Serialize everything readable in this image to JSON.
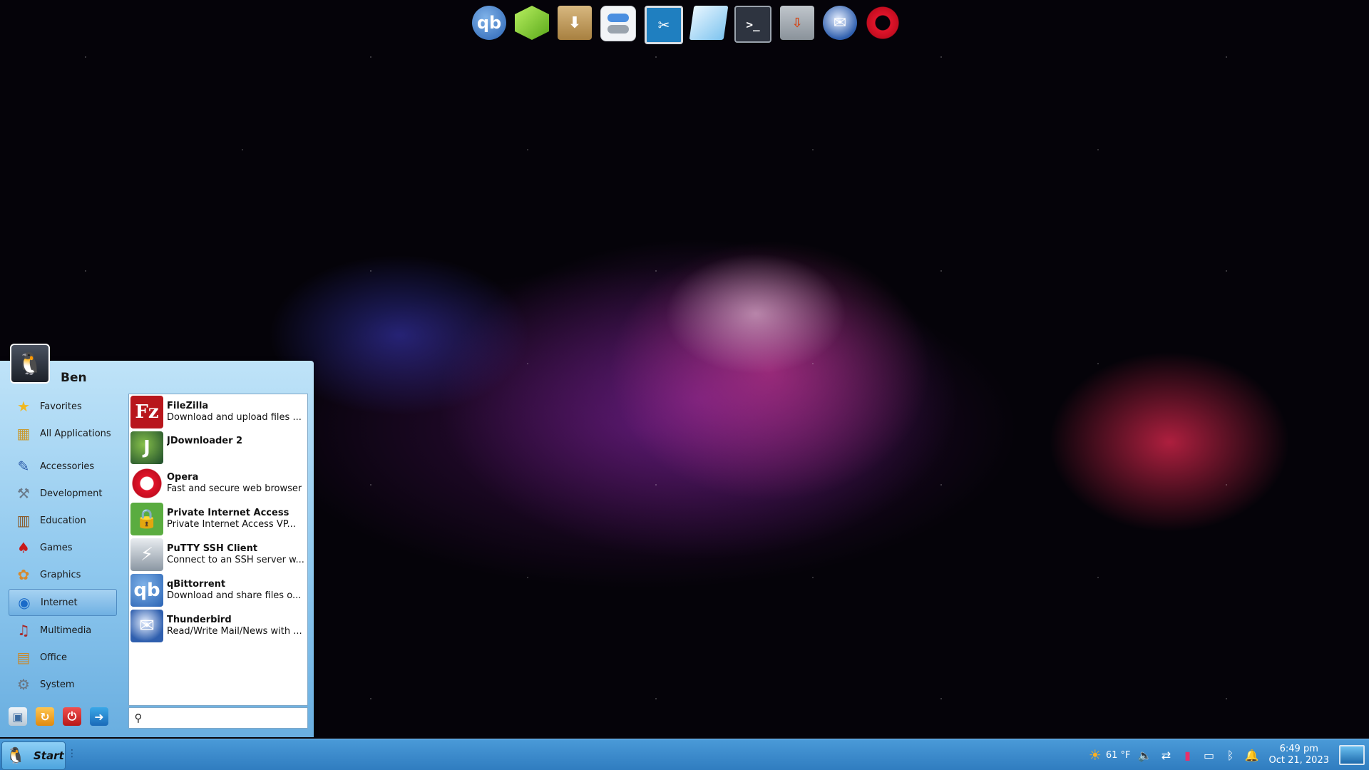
{
  "dock": {
    "icons": [
      {
        "name": "qbittorrent-icon",
        "glyph": "qb"
      },
      {
        "name": "cube-app-icon",
        "glyph": ""
      },
      {
        "name": "archive-manager-icon",
        "glyph": "⬇"
      },
      {
        "name": "settings-toggle-icon",
        "glyph": ""
      },
      {
        "name": "remote-desktop-icon",
        "glyph": "✂"
      },
      {
        "name": "text-editor-icon",
        "glyph": ""
      },
      {
        "name": "terminal-icon",
        "glyph": ">_"
      },
      {
        "name": "network-tool-icon",
        "glyph": "⇩"
      },
      {
        "name": "thunderbird-icon",
        "glyph": "✉"
      },
      {
        "name": "opera-icon",
        "glyph": ""
      }
    ]
  },
  "start_menu": {
    "user_name": "Ben",
    "categories": [
      {
        "label": "Favorites",
        "icon": "★",
        "icon_name": "star-icon"
      },
      {
        "label": "All Applications",
        "icon": "▦",
        "icon_name": "applications-icon"
      },
      {
        "label": "Accessories",
        "icon": "✎",
        "icon_name": "accessories-icon"
      },
      {
        "label": "Development",
        "icon": "⚒",
        "icon_name": "development-icon"
      },
      {
        "label": "Education",
        "icon": "▥",
        "icon_name": "education-icon"
      },
      {
        "label": "Games",
        "icon": "♠",
        "icon_name": "games-icon"
      },
      {
        "label": "Graphics",
        "icon": "✿",
        "icon_name": "graphics-icon"
      },
      {
        "label": "Internet",
        "icon": "◉",
        "icon_name": "globe-icon"
      },
      {
        "label": "Multimedia",
        "icon": "♫",
        "icon_name": "multimedia-icon"
      },
      {
        "label": "Office",
        "icon": "▤",
        "icon_name": "office-icon"
      },
      {
        "label": "System",
        "icon": "⚙",
        "icon_name": "gear-icon"
      }
    ],
    "selected_category": "Internet",
    "apps": [
      {
        "name": "FileZilla",
        "description": "Download and upload files ...",
        "glyph": "Fz",
        "cls": "ai-fz",
        "icon_name": "filezilla-icon"
      },
      {
        "name": "JDownloader 2",
        "description": "",
        "glyph": "J",
        "cls": "ai-jd",
        "icon_name": "jdownloader-icon"
      },
      {
        "name": "Opera",
        "description": "Fast and secure web browser",
        "glyph": "",
        "cls": "ai-op",
        "icon_name": "opera-icon"
      },
      {
        "name": "Private Internet Access",
        "description": "Private Internet Access VP...",
        "glyph": "🔒",
        "cls": "ai-pia",
        "icon_name": "lock-icon"
      },
      {
        "name": "PuTTY SSH Client",
        "description": "Connect to an SSH server w...",
        "glyph": "⚡",
        "cls": "ai-putty",
        "icon_name": "putty-icon"
      },
      {
        "name": "qBittorrent",
        "description": "Download and share files o...",
        "glyph": "qb",
        "cls": "ai-qb",
        "icon_name": "qbittorrent-icon"
      },
      {
        "name": "Thunderbird",
        "description": "Read/Write Mail/News with ...",
        "glyph": "✉",
        "cls": "ai-tb",
        "icon_name": "thunderbird-icon"
      }
    ],
    "search_placeholder": ""
  },
  "taskbar": {
    "start_label": "Start",
    "handle_glyph": "⋮",
    "weather_temp": "61 °F",
    "clock_time": "6:49 pm",
    "clock_date": "Oct 21, 2023",
    "tray_icons": [
      {
        "name": "volume-icon",
        "glyph": "🔈"
      },
      {
        "name": "network-icon",
        "glyph": "⇄"
      },
      {
        "name": "battery-icon",
        "glyph": "▮"
      },
      {
        "name": "drive-icon",
        "glyph": "▭"
      },
      {
        "name": "bluetooth-icon",
        "glyph": "ᛒ"
      },
      {
        "name": "notification-bell-icon",
        "glyph": "🔔"
      }
    ]
  },
  "colors": {
    "taskbar": "#3a8acb",
    "menu_panel": "#8fc8ee",
    "selected_category": "#6fb0e2"
  }
}
